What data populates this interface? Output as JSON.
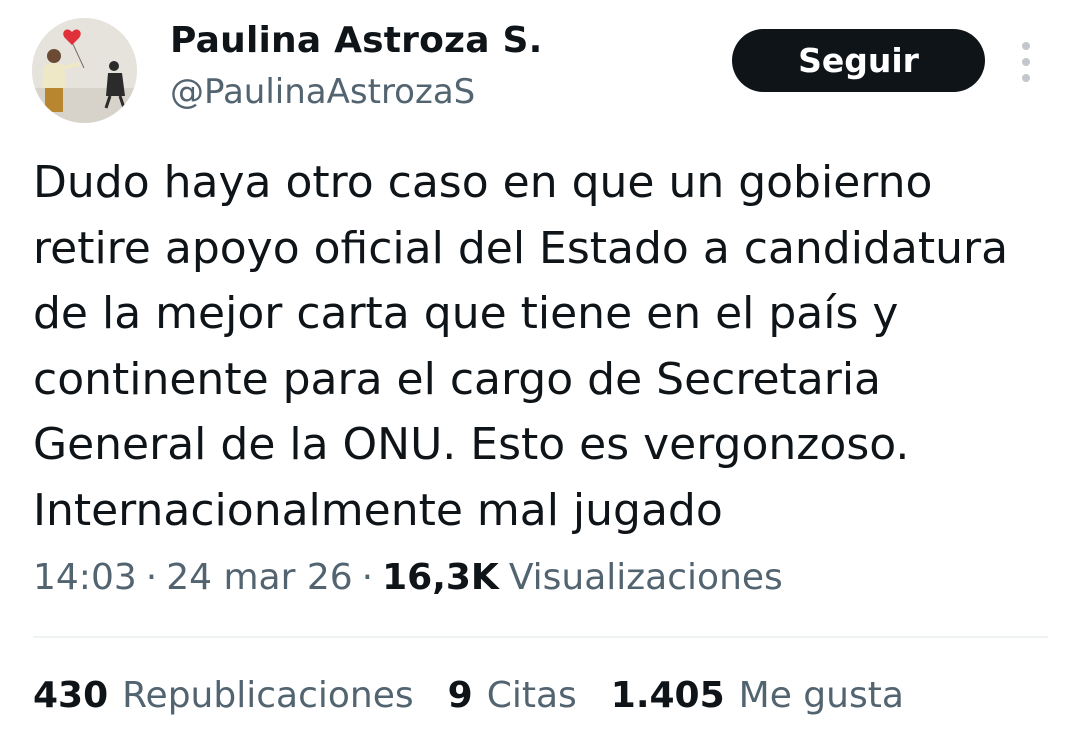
{
  "author": {
    "display_name": "Paulina Astroza S.",
    "handle": "@PaulinaAstrozaS"
  },
  "follow_label": "Seguir",
  "tweet": {
    "lines": [
      "Dudo haya otro caso en que un gobierno",
      "retire apoyo oficial del Estado a candidatura",
      "de la mejor carta que tiene en el país y",
      "continente para el cargo de Secretaria",
      "General de la ONU. Esto es vergonzoso.",
      "Internacionalmente mal jugado"
    ]
  },
  "meta": {
    "time": "14:03",
    "separator": "·",
    "date": "24 mar 26",
    "views_count": "16,3K",
    "views_label": "Visualizaciones"
  },
  "stats": {
    "reposts_count": "430",
    "reposts_label": "Republicaciones",
    "quotes_count": "9",
    "quotes_label": "Citas",
    "likes_count": "1.405",
    "likes_label": "Me gusta"
  },
  "icons": {
    "avatar": "avatar-photo",
    "more": "more-vertical-icon",
    "balloon": "heart-balloon-icon"
  },
  "colors": {
    "text_primary": "#0f1419",
    "text_secondary": "#536471",
    "button_bg": "#0f1419",
    "divider": "#eff3f4"
  }
}
